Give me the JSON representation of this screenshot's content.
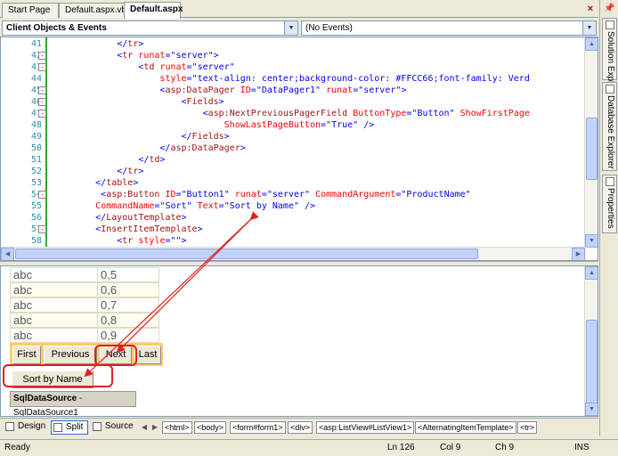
{
  "tabs": [
    {
      "label": "Start Page",
      "active": false
    },
    {
      "label": "Default.aspx.vb",
      "active": false
    },
    {
      "label": "Default.aspx",
      "active": true
    }
  ],
  "close_glyph": "×",
  "dropdowns": {
    "left": "Client Objects & Events",
    "right": "(No Events)"
  },
  "code_lines": [
    {
      "num": "41",
      "fold": "",
      "tokens": [
        {
          "c": "p",
          "t": "            </"
        },
        {
          "c": "t",
          "t": "tr"
        },
        {
          "c": "p",
          "t": ">"
        }
      ]
    },
    {
      "num": "42",
      "fold": "-",
      "tokens": [
        {
          "c": "p",
          "t": "            <"
        },
        {
          "c": "t",
          "t": "tr"
        },
        {
          "c": "k",
          "t": " "
        },
        {
          "c": "a",
          "t": "runat"
        },
        {
          "c": "p",
          "t": "=\"server\">"
        }
      ]
    },
    {
      "num": "43",
      "fold": "-",
      "tokens": [
        {
          "c": "p",
          "t": "                <"
        },
        {
          "c": "t",
          "t": "td"
        },
        {
          "c": "k",
          "t": " "
        },
        {
          "c": "a",
          "t": "runat"
        },
        {
          "c": "p",
          "t": "=\"server\""
        }
      ]
    },
    {
      "num": "44",
      "fold": "",
      "tokens": [
        {
          "c": "k",
          "t": "                    "
        },
        {
          "c": "a",
          "t": "style"
        },
        {
          "c": "p",
          "t": "=\"text-align: center;background-color: #FFCC66;font-family: Verd"
        }
      ]
    },
    {
      "num": "45",
      "fold": "-",
      "tokens": [
        {
          "c": "p",
          "t": "                    <"
        },
        {
          "c": "t",
          "t": "asp:DataPager"
        },
        {
          "c": "k",
          "t": " "
        },
        {
          "c": "a",
          "t": "ID"
        },
        {
          "c": "p",
          "t": "=\"DataPager1\" "
        },
        {
          "c": "a",
          "t": "runat"
        },
        {
          "c": "p",
          "t": "=\"server\">"
        }
      ]
    },
    {
      "num": "46",
      "fold": "-",
      "tokens": [
        {
          "c": "p",
          "t": "                        <"
        },
        {
          "c": "t",
          "t": "Fields"
        },
        {
          "c": "p",
          "t": ">"
        }
      ]
    },
    {
      "num": "47",
      "fold": "-",
      "tokens": [
        {
          "c": "p",
          "t": "                            <"
        },
        {
          "c": "t",
          "t": "asp:NextPreviousPagerField"
        },
        {
          "c": "k",
          "t": " "
        },
        {
          "c": "a",
          "t": "ButtonType"
        },
        {
          "c": "p",
          "t": "=\"Button\" "
        },
        {
          "c": "a",
          "t": "ShowFirstPage"
        }
      ]
    },
    {
      "num": "48",
      "fold": "",
      "tokens": [
        {
          "c": "k",
          "t": "                                "
        },
        {
          "c": "a",
          "t": "ShowLastPageButton"
        },
        {
          "c": "p",
          "t": "=\"True\" />"
        }
      ]
    },
    {
      "num": "49",
      "fold": "",
      "tokens": [
        {
          "c": "p",
          "t": "                        </"
        },
        {
          "c": "t",
          "t": "Fields"
        },
        {
          "c": "p",
          "t": ">"
        }
      ]
    },
    {
      "num": "50",
      "fold": "",
      "tokens": [
        {
          "c": "p",
          "t": "                    </"
        },
        {
          "c": "t",
          "t": "asp:DataPager"
        },
        {
          "c": "p",
          "t": ">"
        }
      ]
    },
    {
      "num": "51",
      "fold": "",
      "tokens": [
        {
          "c": "p",
          "t": "                </"
        },
        {
          "c": "t",
          "t": "td"
        },
        {
          "c": "p",
          "t": ">"
        }
      ]
    },
    {
      "num": "52",
      "fold": "",
      "tokens": [
        {
          "c": "p",
          "t": "            </"
        },
        {
          "c": "t",
          "t": "tr"
        },
        {
          "c": "p",
          "t": ">"
        }
      ]
    },
    {
      "num": "53",
      "fold": "",
      "tokens": [
        {
          "c": "p",
          "t": "        </"
        },
        {
          "c": "t",
          "t": "table"
        },
        {
          "c": "p",
          "t": ">"
        }
      ]
    },
    {
      "num": "54",
      "fold": "-",
      "tokens": [
        {
          "c": "p",
          "t": "         <"
        },
        {
          "c": "t",
          "t": "asp:Button"
        },
        {
          "c": "k",
          "t": " "
        },
        {
          "c": "a",
          "t": "ID"
        },
        {
          "c": "p",
          "t": "=\"Button1\" "
        },
        {
          "c": "a",
          "t": "runat"
        },
        {
          "c": "p",
          "t": "=\"server\" "
        },
        {
          "c": "a",
          "t": "CommandArgument"
        },
        {
          "c": "p",
          "t": "=\"ProductName\""
        }
      ]
    },
    {
      "num": "55",
      "fold": "",
      "tokens": [
        {
          "c": "k",
          "t": "        "
        },
        {
          "c": "a",
          "t": "CommandName"
        },
        {
          "c": "p",
          "t": "=\"Sort\" "
        },
        {
          "c": "a",
          "t": "Text"
        },
        {
          "c": "p",
          "t": "=\"Sort by Name\" />"
        }
      ]
    },
    {
      "num": "56",
      "fold": "",
      "tokens": [
        {
          "c": "p",
          "t": "        </"
        },
        {
          "c": "t",
          "t": "LayoutTemplate"
        },
        {
          "c": "p",
          "t": ">"
        }
      ]
    },
    {
      "num": "57",
      "fold": "-",
      "tokens": [
        {
          "c": "p",
          "t": "        <"
        },
        {
          "c": "t",
          "t": "InsertItemTemplate"
        },
        {
          "c": "p",
          "t": ">"
        }
      ]
    },
    {
      "num": "58",
      "fold": "",
      "tokens": [
        {
          "c": "p",
          "t": "            <"
        },
        {
          "c": "t",
          "t": "tr"
        },
        {
          "c": "k",
          "t": " "
        },
        {
          "c": "a",
          "t": "style"
        },
        {
          "c": "p",
          "t": "=\"\">"
        }
      ]
    }
  ],
  "design_rows": [
    {
      "name": "abc",
      "value": "0,5"
    },
    {
      "name": "abc",
      "value": "0,6"
    },
    {
      "name": "abc",
      "value": "0,7"
    },
    {
      "name": "abc",
      "value": "0,8"
    },
    {
      "name": "abc",
      "value": "0,9"
    }
  ],
  "pager": {
    "first": "First",
    "previous": "Previous",
    "next": "Next",
    "last": "Last"
  },
  "sort_button": "Sort by Name",
  "sql_datasource": {
    "type": "SqlDataSource",
    "separator": " - ",
    "name": "SqlDataSource1"
  },
  "view_buttons": [
    {
      "label": "Design",
      "active": false
    },
    {
      "label": "Split",
      "active": true
    },
    {
      "label": "Source",
      "active": false
    }
  ],
  "breadcrumbs": [
    "<html>",
    "<body>",
    "<form#form1>",
    "<div>",
    "<asp:ListView#ListView1>",
    "<AlternatingItemTemplate>",
    "<tr>"
  ],
  "status": {
    "text": "Ready",
    "line": "Ln 126",
    "col": "Col 9",
    "ch": "Ch 9",
    "mode": "INS"
  },
  "right_panels": [
    "Solution Explorer",
    "Database Explorer",
    "Properties"
  ],
  "colors": {
    "pager_bg": "#FFCC66",
    "callout": "#E02020",
    "tag": "#A31515",
    "attr": "#FF0000",
    "value": "#0000FF"
  }
}
